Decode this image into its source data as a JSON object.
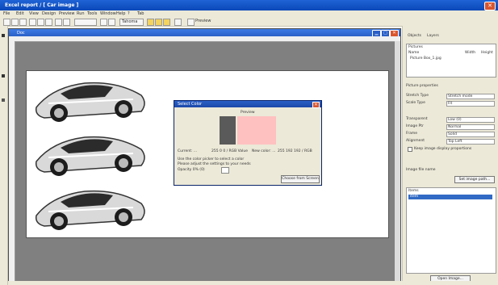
{
  "app": {
    "title": "Excel report / [ Car image ]",
    "colors": {
      "titlebar": "#0b48b8",
      "chrome": "#ece9d8",
      "workspace": "#808080",
      "pink_swatch": "#ffc0c0",
      "gray_swatch": "#5a5a5a"
    }
  },
  "menubar": {
    "items": [
      "File",
      "Edit",
      "View",
      "Design",
      "Preview",
      "Run",
      "Tools",
      "Window",
      "Help",
      "?",
      "Tab"
    ]
  },
  "toolbar": {
    "font_label": "Tahoma",
    "preview_label": "Preview"
  },
  "document": {
    "title": "Doc",
    "images": [
      {
        "name": "car-image-1",
        "subject": "silver sports car"
      },
      {
        "name": "car-image-2",
        "subject": "silver sports car"
      },
      {
        "name": "car-image-3",
        "subject": "silver sports car"
      }
    ]
  },
  "dialog": {
    "title": "Select Color",
    "section_label": "Preview",
    "left_value": "Current: ...",
    "left_readout": "255 0 0 / RGB Value",
    "right_value": "New color: ...",
    "right_readout": "255 192 192 / RGB",
    "hint_line1": "Use the color picker to select a color",
    "hint_line2": "Please adjust the settings to your needs",
    "transparency_label": "Opacity 0% (0)",
    "ok_label": "Choose from Screen"
  },
  "rightpanel": {
    "tabs": [
      "Objects",
      "Layers"
    ],
    "objects_header": "Pictures",
    "objects_columns": [
      "Name",
      "Width",
      "Height"
    ],
    "objects_row": "Picture Box_1.jpg",
    "properties_header": "Picture properties",
    "prop_rows": [
      {
        "label": "Stretch Type",
        "value": "Stretch mode"
      },
      {
        "label": "Scale Type",
        "value": "Fit"
      },
      {
        "label": "Transparent",
        "value": "Low (0)"
      },
      {
        "label": "Image Ptr",
        "value": "Normal"
      },
      {
        "label": "Frame",
        "value": "Solid"
      },
      {
        "label": "Alignment",
        "value": "Top Left"
      }
    ],
    "checkbox_label": "Keep image display proportions",
    "image_label": "Image file name",
    "browse_label": "Set image path...",
    "list_header": "Items",
    "list_selected": "item",
    "bottom_button": "Open Image..."
  }
}
